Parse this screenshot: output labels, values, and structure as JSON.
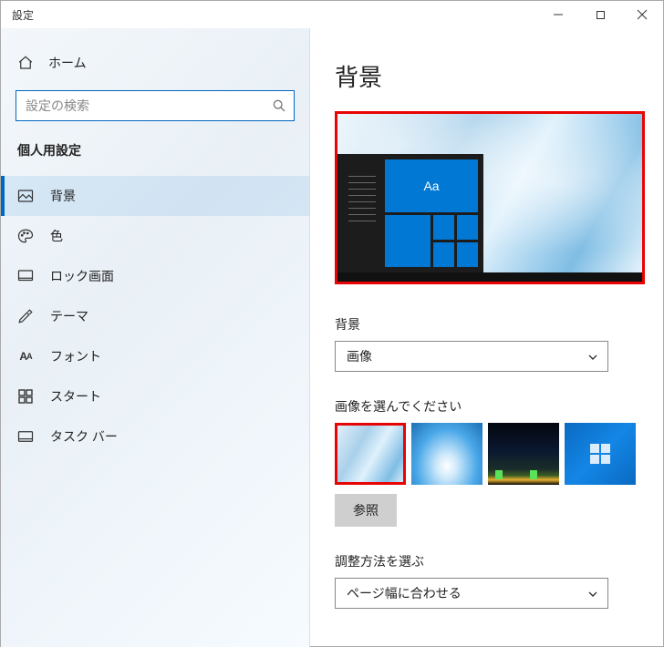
{
  "window": {
    "title": "設定"
  },
  "home": {
    "label": "ホーム"
  },
  "search": {
    "placeholder": "設定の検索"
  },
  "section": {
    "title": "個人用設定"
  },
  "nav": {
    "items": [
      {
        "label": "背景"
      },
      {
        "label": "色"
      },
      {
        "label": "ロック画面"
      },
      {
        "label": "テーマ"
      },
      {
        "label": "フォント"
      },
      {
        "label": "スタート"
      },
      {
        "label": "タスク バー"
      }
    ]
  },
  "page": {
    "title": "背景"
  },
  "preview": {
    "sample_text": "Aa"
  },
  "background": {
    "label": "背景",
    "selected": "画像"
  },
  "choose_image": {
    "label": "画像を選んでください",
    "browse": "参照"
  },
  "fit": {
    "label": "調整方法を選ぶ",
    "selected": "ページ幅に合わせる"
  }
}
